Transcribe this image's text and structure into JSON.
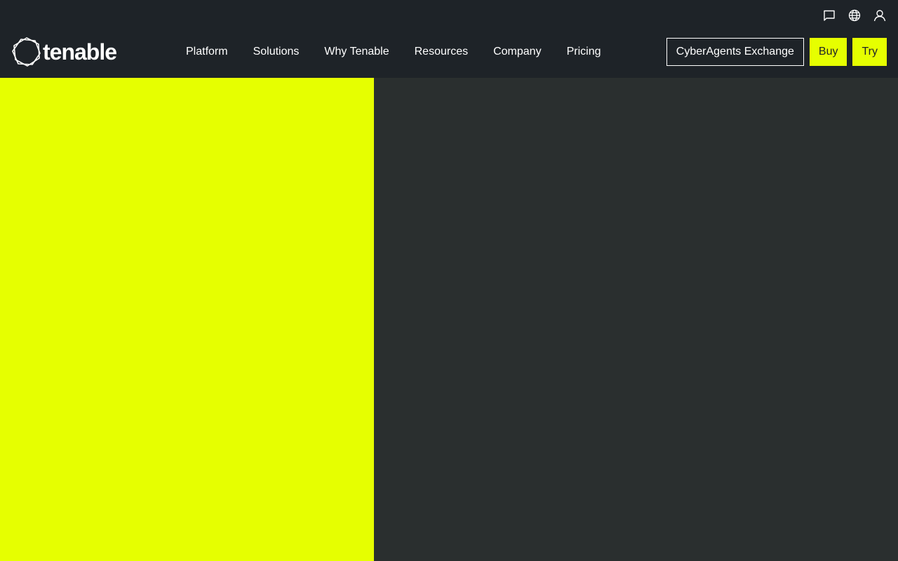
{
  "brand": {
    "name": "tenable",
    "logo_icon": "hexagon-logo-icon"
  },
  "utility": {
    "items": [
      {
        "icon": "chat-icon",
        "label": "Contact"
      },
      {
        "icon": "globe-icon",
        "label": "Language"
      },
      {
        "icon": "user-icon",
        "label": "Account"
      }
    ]
  },
  "nav": {
    "items": [
      {
        "label": "Platform"
      },
      {
        "label": "Solutions"
      },
      {
        "label": "Why Tenable"
      },
      {
        "label": "Resources"
      },
      {
        "label": "Company"
      },
      {
        "label": "Pricing"
      }
    ]
  },
  "actions": {
    "exchange_label": "CyberAgents Exchange",
    "buy_label": "Buy",
    "try_label": "Try"
  },
  "colors": {
    "header_bg": "#1e2328",
    "accent": "#e6ff00",
    "hero_dark": "#2a2f2f",
    "text": "#ffffff"
  }
}
